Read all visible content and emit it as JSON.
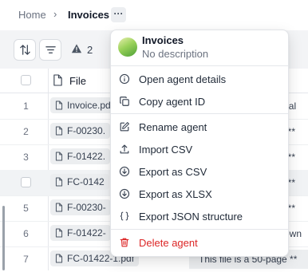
{
  "breadcrumb": {
    "home": "Home",
    "separator": "›",
    "current": "Invoices",
    "more": "···"
  },
  "toolbar": {
    "warnings_count": "2"
  },
  "table": {
    "header": {
      "file": "File"
    },
    "rows": [
      {
        "num": "1",
        "file": "Invoice.pd",
        "text": "fficial"
      },
      {
        "num": "2",
        "file": "F-00230.",
        "text": "ge **"
      },
      {
        "num": "3",
        "file": "F-01422.",
        "text": "ge **"
      },
      {
        "num": "",
        "file": "FC-0142",
        "text": "ge **"
      },
      {
        "num": "5",
        "file": "F-00230-",
        "text": "ge **"
      },
      {
        "num": "6",
        "file": "F-01422-",
        "text": "own"
      },
      {
        "num": "7",
        "file": "FC-01422-1.pdf",
        "text": "This file is a 50-page **"
      }
    ]
  },
  "menu": {
    "title": "Invoices",
    "subtitle": "No description",
    "items": [
      {
        "label": "Open agent details",
        "icon": "info-icon"
      },
      {
        "label": "Copy agent ID",
        "icon": "copy-icon"
      },
      {
        "label": "Rename agent",
        "icon": "edit-icon"
      },
      {
        "label": "Import CSV",
        "icon": "upload-icon"
      },
      {
        "label": "Export as CSV",
        "icon": "download-circle-icon"
      },
      {
        "label": "Export as XLSX",
        "icon": "download-circle-icon"
      },
      {
        "label": "Export JSON structure",
        "icon": "braces-icon"
      },
      {
        "label": "Delete agent",
        "icon": "trash-icon"
      }
    ]
  },
  "colors": {
    "danger": "#dc2626",
    "accent_avatar": "#7cc04a"
  }
}
